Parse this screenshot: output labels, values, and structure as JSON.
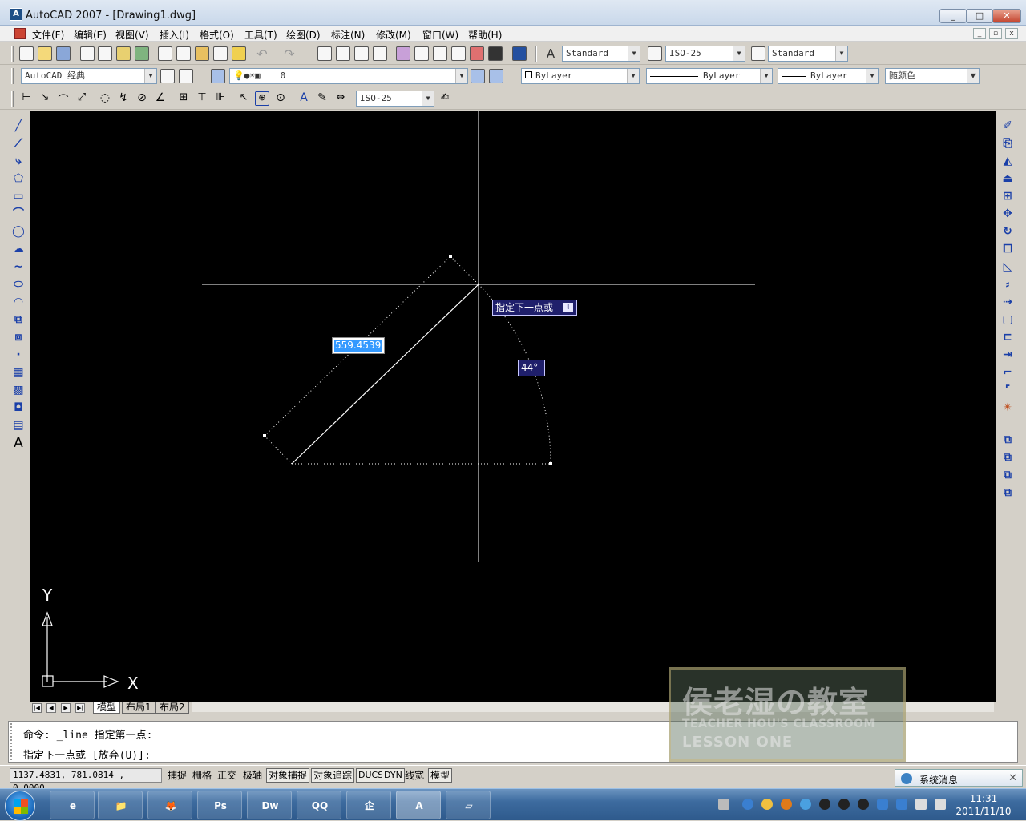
{
  "window": {
    "title": "AutoCAD 2007 - [Drawing1.dwg]",
    "minimize": "_",
    "maximize": "□",
    "close": "✕"
  },
  "menu": [
    "文件(F)",
    "编辑(E)",
    "视图(V)",
    "插入(I)",
    "格式(O)",
    "工具(T)",
    "绘图(D)",
    "标注(N)",
    "修改(M)",
    "窗口(W)",
    "帮助(H)"
  ],
  "toolbars": {
    "text_style": "Standard",
    "dim_style": "ISO-25",
    "table_style": "Standard",
    "workspace": "AutoCAD 经典",
    "layer": "0",
    "color": "ByLayer",
    "linetype": "ByLayer",
    "lineweight": "ByLayer",
    "plot_style": "随颜色",
    "dim_style_2": "ISO-25"
  },
  "canvas": {
    "dyn_prompt": "指定下一点或",
    "dyn_prompt_icon": "⇩",
    "length_value": "559.4539",
    "angle_value": "44°",
    "ucs_y": "Y",
    "ucs_x": "X"
  },
  "layout_tabs": [
    "模型",
    "布局1",
    "布局2"
  ],
  "layout_nav": [
    "|◀",
    "◀",
    "▶",
    "▶|"
  ],
  "command_lines": [
    "命令: _line 指定第一点:",
    "指定下一点或 [放弃(U)]:"
  ],
  "status": {
    "coords": "1137.4831, 781.0814 , 0.0000",
    "buttons": [
      {
        "label": "捕捉",
        "on": false
      },
      {
        "label": "栅格",
        "on": false
      },
      {
        "label": "正交",
        "on": false
      },
      {
        "label": "极轴",
        "on": false
      },
      {
        "label": "对象捕捉",
        "on": true
      },
      {
        "label": "对象追踪",
        "on": true
      },
      {
        "label": "DUCS",
        "on": true
      },
      {
        "label": "DYN",
        "on": true
      },
      {
        "label": "线宽",
        "on": false
      },
      {
        "label": "模型",
        "on": true
      }
    ]
  },
  "watermark": {
    "line1": "侯老湿の教室",
    "line2": "TEACHER HOU'S CLASSROOM",
    "line3": "LESSON ONE"
  },
  "notification": {
    "text": "系统消息",
    "close": "✕"
  },
  "taskbar": {
    "apps": [
      {
        "label": "e",
        "color": "#1e7fd8"
      },
      {
        "label": "📁",
        "color": "#d9a93a"
      },
      {
        "label": "🦊",
        "color": "#e06a1a"
      },
      {
        "label": "Ps",
        "color": "#0d2a4f"
      },
      {
        "label": "Dw",
        "color": "#2b5a1a"
      },
      {
        "label": "QQ",
        "color": "#222222"
      },
      {
        "label": "企",
        "color": "#e07a1a"
      },
      {
        "label": "A",
        "color": "#1a6a5a"
      },
      {
        "label": "▱",
        "color": "#6aa0c8"
      }
    ],
    "time": "11:31",
    "date": "2011/11/10"
  },
  "colors": {
    "canvas_bg": "#000000",
    "dyn_bg": "#1f1f6b",
    "highlight": "#3399ff"
  }
}
